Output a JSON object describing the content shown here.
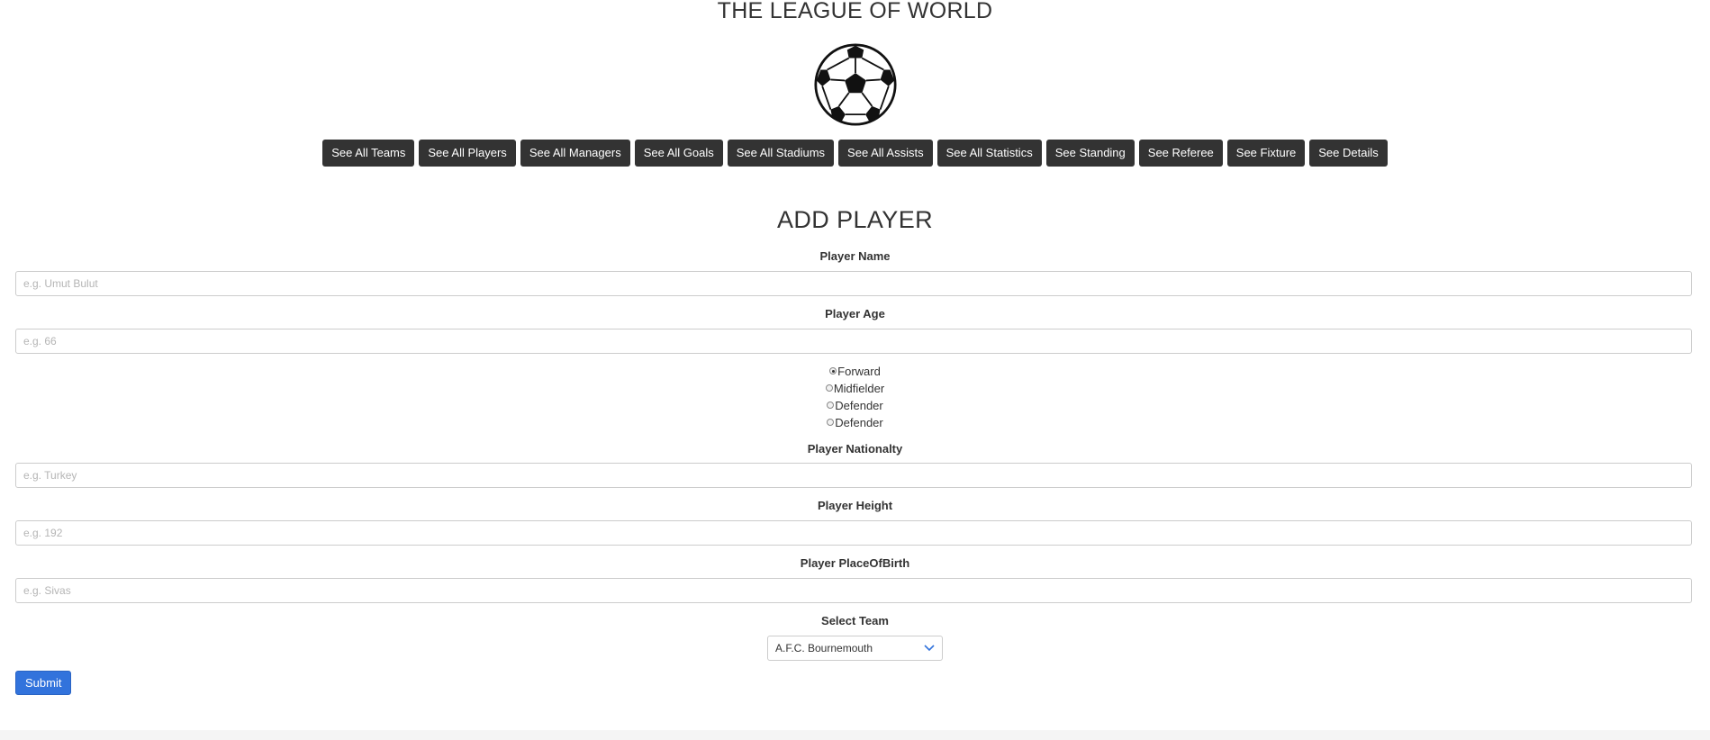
{
  "header": {
    "title": "THE LEAGUE OF WORLD",
    "logo_icon": "soccer-ball-icon"
  },
  "nav": {
    "buttons": [
      {
        "label": "See All Teams"
      },
      {
        "label": "See All Players"
      },
      {
        "label": "See All Managers"
      },
      {
        "label": "See All Goals"
      },
      {
        "label": "See All Stadiums"
      },
      {
        "label": "See All Assists"
      },
      {
        "label": "See All Statistics"
      },
      {
        "label": "See Standing"
      },
      {
        "label": "See Referee"
      },
      {
        "label": "See Fixture"
      },
      {
        "label": "See Details"
      }
    ]
  },
  "form": {
    "title": "ADD PLAYER",
    "name": {
      "label": "Player Name",
      "placeholder": "e.g. Umut Bulut",
      "value": ""
    },
    "age": {
      "label": "Player Age",
      "placeholder": "e.g. 66",
      "value": ""
    },
    "positions": [
      {
        "label": "Forward",
        "checked": true
      },
      {
        "label": "Midfielder",
        "checked": false
      },
      {
        "label": "Defender",
        "checked": false
      },
      {
        "label": "Defender",
        "checked": false
      }
    ],
    "nationality": {
      "label": "Player Nationalty",
      "placeholder": "e.g. Turkey",
      "value": ""
    },
    "height": {
      "label": "Player Height",
      "placeholder": "e.g. 192",
      "value": ""
    },
    "birthplace": {
      "label": "Player PlaceOfBirth",
      "placeholder": "e.g. Sivas",
      "value": ""
    },
    "team": {
      "label": "Select Team",
      "selected": "A.F.C. Bournemouth"
    },
    "submit_label": "Submit"
  },
  "colors": {
    "nav_button_bg": "#333333",
    "submit_bg": "#3273dc",
    "text": "#333333"
  }
}
